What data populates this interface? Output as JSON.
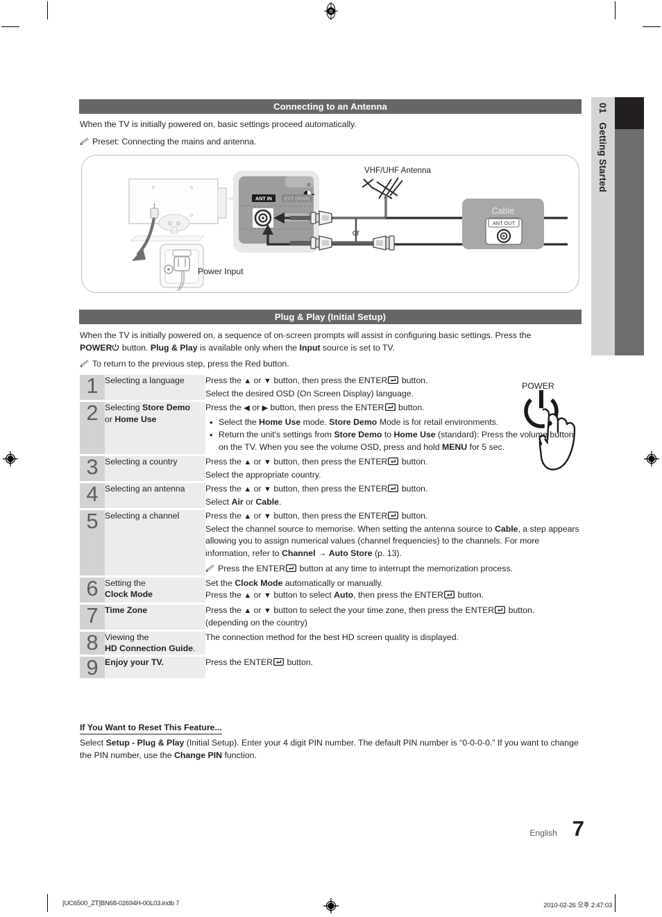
{
  "chapter_tab": {
    "number": "01",
    "label": "Getting Started"
  },
  "sections": {
    "antenna": {
      "header": "Connecting to an Antenna",
      "intro": "When the TV is initially powered on, basic settings proceed automatically.",
      "note": "Preset: Connecting the mains and antenna.",
      "diagram": {
        "antenna_label": "VHF/UHF Antenna",
        "cable_box_label": "Cable",
        "ant_out_label": "ANT OUT",
        "ant_in_label": "ANT IN",
        "ext_rgb_label": "EXT (RGB)",
        "or_label": "or",
        "power_input_label": "Power Input"
      }
    },
    "plug_play": {
      "header": "Plug & Play (Initial Setup)",
      "intro_part1": "When the TV is initially powered on, a sequence of on-screen prompts will assist in configuring basic settings. Press the ",
      "intro_power": "POWER",
      "intro_part2": " button. ",
      "intro_bold1": "Plug & Play",
      "intro_part3": " is available only when the ",
      "intro_bold2": "Input",
      "intro_part4": " source is set to TV.",
      "note": "To return to the previous step, press the Red button.",
      "power_illustration_label": "POWER",
      "steps": [
        {
          "number": "1",
          "title_plain": "Selecting a language",
          "lines": [
            "Press the ▲ or ▼ button, then press the ENTER↵ button.",
            "Select the desired OSD (On Screen Display) language."
          ]
        },
        {
          "number": "2",
          "title_plain_1": "Selecting ",
          "title_bold_1": "Store Demo",
          "title_plain_2": "or ",
          "title_bold_2": "Home Use",
          "lead": "Press the ◀ or ▶ button, then press the ENTER↵ button.",
          "bullets": [
            "Select the Home Use mode. Store Demo Mode is for retail environments.",
            "Return the unit's settings from Store Demo to Home Use (standard): Press the volume button on the TV. When you see the volume OSD, press and hold MENU for 5 sec."
          ]
        },
        {
          "number": "3",
          "title_plain": "Selecting a country",
          "lines": [
            "Press the ▲ or ▼ button, then press the ENTER↵ button.",
            "Select the appropriate country."
          ]
        },
        {
          "number": "4",
          "title_plain": "Selecting an antenna",
          "lines": [
            "Press the ▲ or ▼ button, then press the ENTER↵ button.",
            "Select Air or Cable."
          ]
        },
        {
          "number": "5",
          "title_plain": "Selecting a channel",
          "lead": "Press the ▲ or ▼ button, then press the ENTER↵ button.",
          "body": "Select the channel source to memorise. When setting the antenna source to Cable, a step appears allowing you to assign numerical values (channel frequencies) to the channels. For more information, refer to Channel → Auto Store (p. 13).",
          "note": "Press the ENTER↵ button at any time to interrupt the memorization process."
        },
        {
          "number": "6",
          "title_plain": "Setting the",
          "title_bold": "Clock Mode",
          "lines": [
            "Set the Clock Mode automatically or manually.",
            "Press the ▲ or ▼ button to select Auto, then press the ENTER↵ button."
          ]
        },
        {
          "number": "7",
          "title_bold": "Time Zone",
          "lines": [
            "Press the ▲ or ▼ button to select the your time zone, then press the ENTER↵ button.",
            "(depending on the country)"
          ]
        },
        {
          "number": "8",
          "title_plain": "Viewing the",
          "title_bold": "HD Connection Guide",
          "title_suffix": ".",
          "lines": [
            "The connection method for the best HD screen quality is displayed."
          ]
        },
        {
          "number": "9",
          "title_bold": "Enjoy your TV.",
          "lines": [
            "Press the ENTER↵ button."
          ]
        }
      ]
    },
    "reset": {
      "heading": "If You Want to Reset This Feature...",
      "body_p1": "Select ",
      "body_b1": "Setup - Plug & Play",
      "body_p2": " (Initial Setup). Enter your 4 digit PIN number. The default PIN number is “0-0-0-0.” If you want to change the PIN number, use the ",
      "body_b2": "Change PIN",
      "body_p3": " function."
    }
  },
  "page_footer": {
    "language": "English",
    "number": "7"
  },
  "print_footer": {
    "file": "[UC6500_ZT]BN68-02694H-00L03.indb   7",
    "date": "2010-02-26   오후 2:47:03"
  },
  "colors": {
    "header_bar": "#666666",
    "tab_light": "#d4d4d4",
    "tab_dark": "#231f20",
    "tab_gray": "#6d6d6d",
    "num_cell": "#d2d2d2",
    "title_cell": "#ececec",
    "text": "#231f20"
  }
}
